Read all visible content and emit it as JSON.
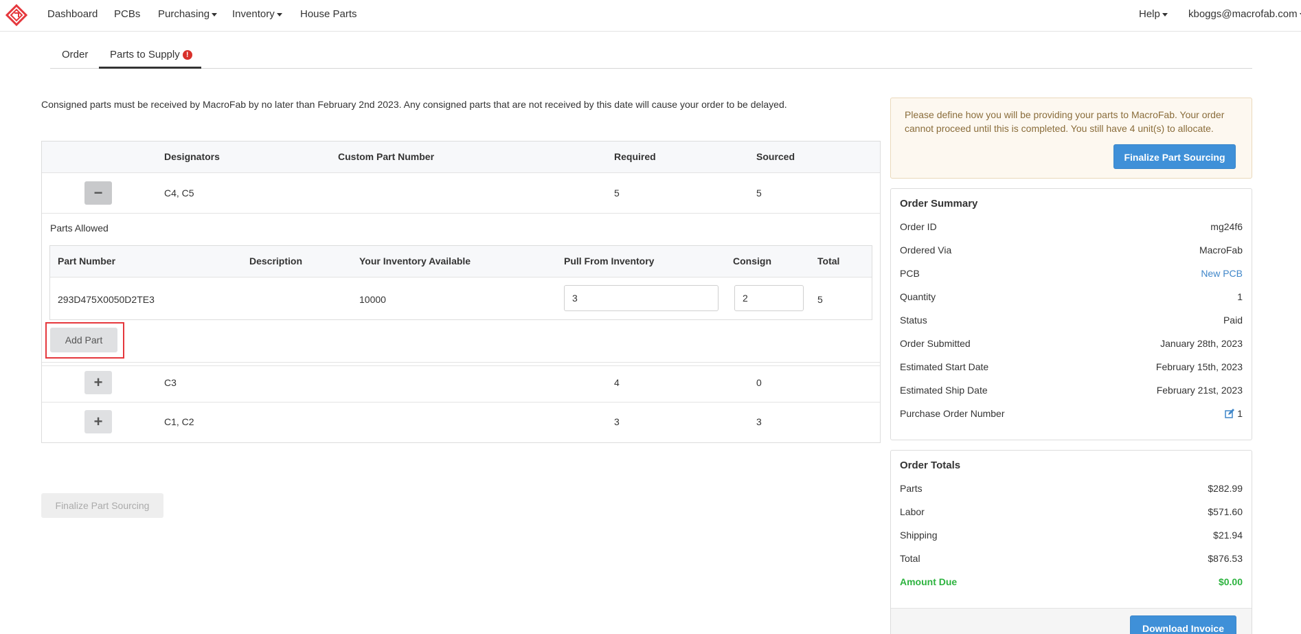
{
  "nav": {
    "items": [
      {
        "label": "Dashboard",
        "dropdown": false
      },
      {
        "label": "PCBs",
        "dropdown": false
      },
      {
        "label": "Purchasing",
        "dropdown": true
      },
      {
        "label": "Inventory",
        "dropdown": true
      },
      {
        "label": "House Parts",
        "dropdown": false
      }
    ],
    "help": "Help",
    "user": "kboggs@macrofab.com",
    "logo_icon": "macrofab-logo-icon"
  },
  "tabs": [
    {
      "label": "Order",
      "active": false
    },
    {
      "label": "Parts to Supply",
      "active": true,
      "alert": "!"
    }
  ],
  "notice": "Consigned parts must be received by MacroFab by no later than February 2nd 2023.  Any consigned parts that are not received by this date will cause your order to be delayed.",
  "parts_table": {
    "headers": [
      "Designators",
      "Custom Part Number",
      "Required",
      "Sourced"
    ],
    "rows": [
      {
        "toggle": "−",
        "designators": "C4, C5",
        "custom_part_number": "",
        "required": "5",
        "sourced": "5",
        "expanded": true
      },
      {
        "toggle": "+",
        "designators": "C3",
        "custom_part_number": "",
        "required": "4",
        "sourced": "0",
        "expanded": false
      },
      {
        "toggle": "+",
        "designators": "C1, C2",
        "custom_part_number": "",
        "required": "3",
        "sourced": "3",
        "expanded": false
      }
    ],
    "parts_allowed_label": "Parts Allowed",
    "inner_headers": [
      "Part Number",
      "Description",
      "Your Inventory Available",
      "Pull From Inventory",
      "Consign",
      "Total"
    ],
    "inner_row": {
      "part_number": "293D475X0050D2TE3",
      "description": "",
      "inventory_available": "10000",
      "pull_from_inventory": "3",
      "consign": "2",
      "total": "5"
    },
    "add_part_label": "Add Part"
  },
  "finalize_disabled_label": "Finalize Part Sourcing",
  "warning": {
    "text": "Please define how you will be providing your parts to MacroFab. Your order cannot proceed until this is completed. You still have 4 unit(s) to allocate.",
    "button": "Finalize Part Sourcing"
  },
  "order_summary": {
    "title": "Order Summary",
    "rows": [
      {
        "label": "Order ID",
        "value": "mg24f6"
      },
      {
        "label": "Ordered Via",
        "value": "MacroFab"
      },
      {
        "label": "PCB",
        "value": "New PCB"
      },
      {
        "label": "Quantity",
        "value": "1"
      },
      {
        "label": "Status",
        "value": "Paid"
      },
      {
        "label": "Order Submitted",
        "value": "January 28th, 2023"
      },
      {
        "label": "Estimated Start Date",
        "value": "February 15th, 2023"
      },
      {
        "label": "Estimated Ship Date",
        "value": "February 21st, 2023"
      },
      {
        "label": "Purchase Order Number",
        "value": "1"
      }
    ]
  },
  "order_totals": {
    "title": "Order Totals",
    "rows": [
      {
        "label": "Parts",
        "value": "$282.99"
      },
      {
        "label": "Labor",
        "value": "$571.60"
      },
      {
        "label": "Shipping",
        "value": "$21.94"
      },
      {
        "label": "Total",
        "value": "$876.53"
      },
      {
        "label": "Amount Due",
        "value": "$0.00"
      }
    ],
    "download_button": "Download Invoice"
  },
  "colors": {
    "accent_blue": "#3f90d8",
    "alert_red": "#d9312b",
    "amount_due_green": "#2db33f",
    "highlight_red": "#e5373c"
  }
}
